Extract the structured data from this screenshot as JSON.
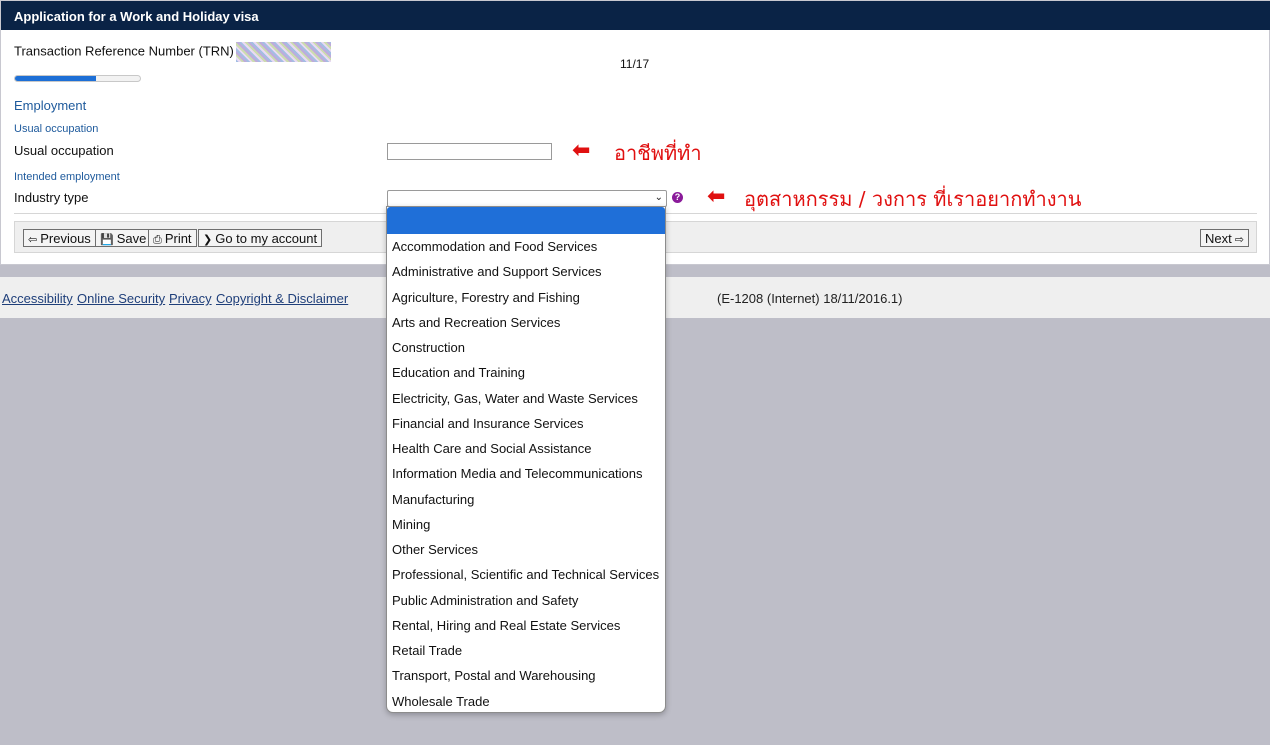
{
  "window": {
    "title": "Application for a Work and Holiday visa"
  },
  "header": {
    "trn_label": "Transaction Reference Number (TRN)",
    "step_indicator": "11/17",
    "progress_fraction": 0.65
  },
  "section": {
    "title": "Employment",
    "usual_occupation_heading": "Usual occupation",
    "usual_occupation_label": "Usual occupation",
    "usual_occupation_value": "",
    "intended_employment_heading": "Intended employment",
    "industry_type_label": "Industry type",
    "industry_type_value": ""
  },
  "annotations": {
    "occupation_note": "อาชีพที่ทำ",
    "industry_note": "อุตสาหกรรม / วงการ ที่เราอยากทำงาน",
    "arrow_color": "#e01010"
  },
  "buttons": {
    "previous": "Previous",
    "save": "Save",
    "print": "Print",
    "account": "Go to my account",
    "next": "Next"
  },
  "footer": {
    "links": [
      "Accessibility",
      "Online Security",
      "Privacy",
      "Copyright & Disclaimer"
    ],
    "version": "(E-1208 (Internet) 18/11/2016.1)"
  },
  "dropdown": {
    "options": [
      "",
      "Accommodation and Food Services",
      "Administrative and Support Services",
      "Agriculture, Forestry and Fishing",
      "Arts and Recreation Services",
      "Construction",
      "Education and Training",
      "Electricity, Gas, Water and Waste Services",
      "Financial and Insurance Services",
      "Health Care and Social Assistance",
      "Information Media and Telecommunications",
      "Manufacturing",
      "Mining",
      "Other Services",
      "Professional, Scientific and Technical Services",
      "Public Administration and Safety",
      "Rental, Hiring and Real Estate Services",
      "Retail Trade",
      "Transport, Postal and Warehousing",
      "Wholesale Trade"
    ],
    "selected_index": 0
  },
  "colors": {
    "titlebar": "#0a2346",
    "accent": "#1f6fd8",
    "section_heading": "#1e5a9c",
    "help_icon": "#8a1a9a"
  },
  "icons": {
    "previous": "arrow-left-icon",
    "save": "floppy-disk-icon",
    "print": "printer-icon",
    "account": "chevron-right-icon",
    "next": "arrow-right-icon",
    "help": "question-circle-icon",
    "select": "chevron-down-icon"
  }
}
